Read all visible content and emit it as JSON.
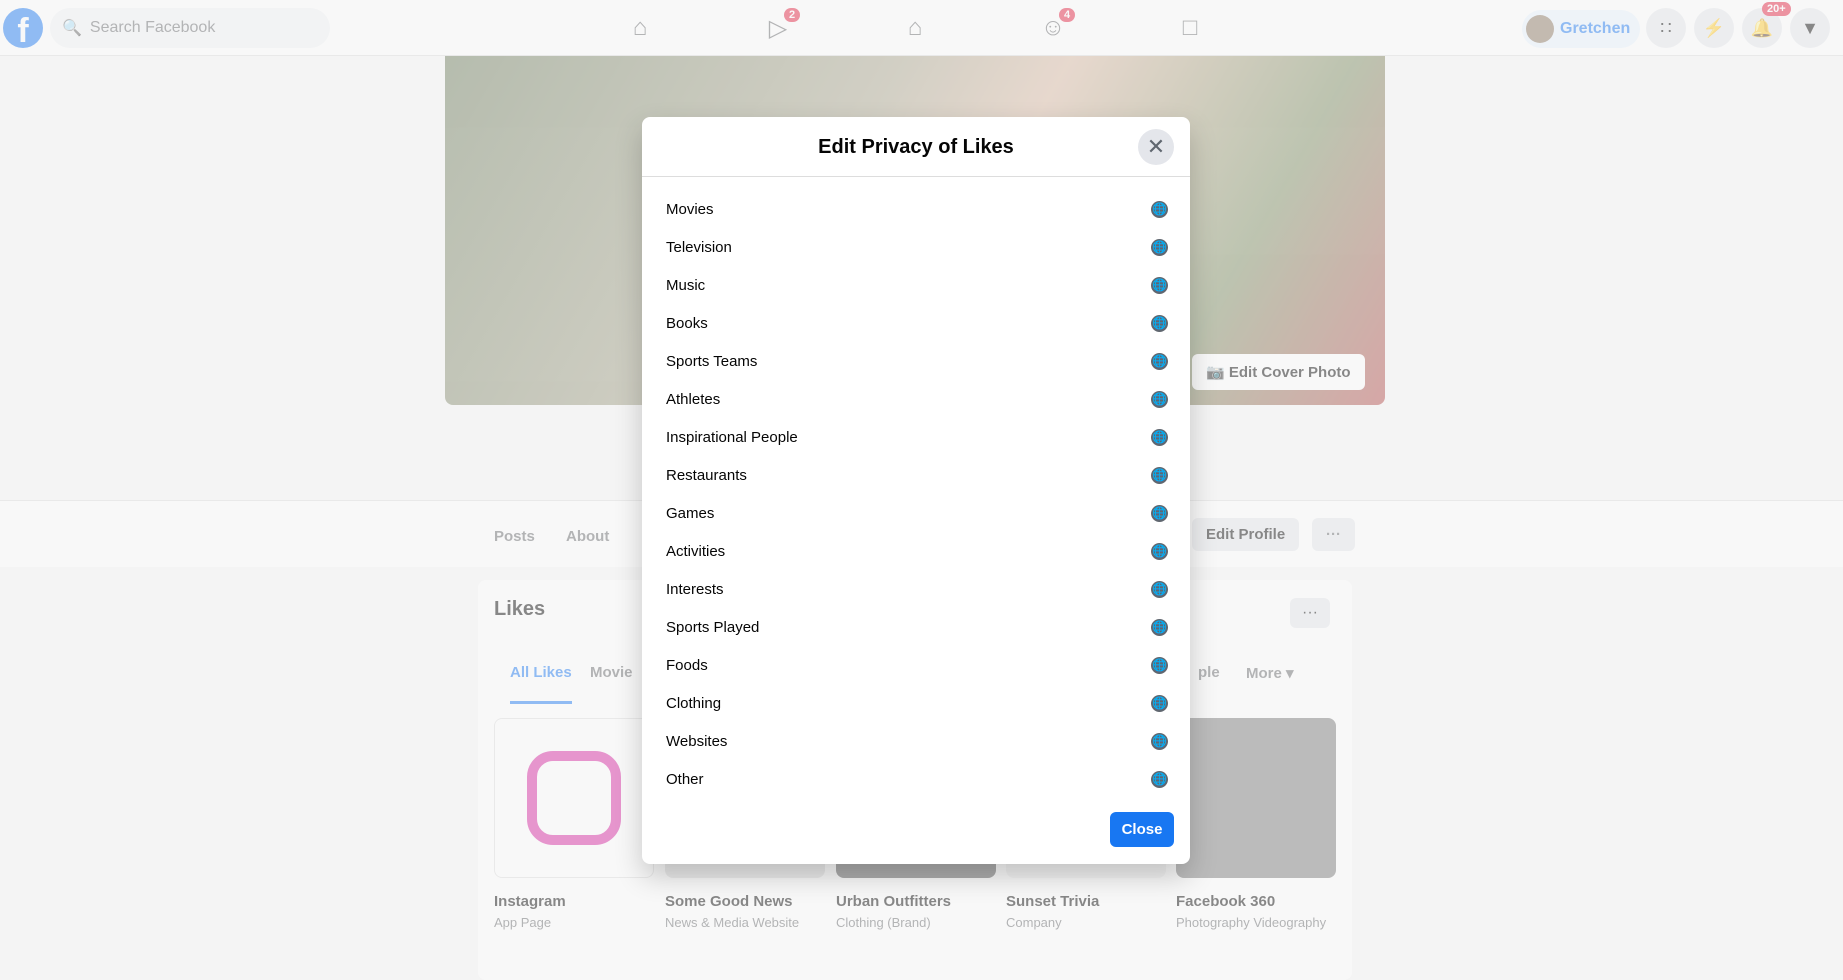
{
  "topbar": {
    "logo": "f",
    "search_placeholder": "Search Facebook",
    "watch_badge": "2",
    "groups_badge": "4",
    "user_name": "Gretchen",
    "notifications_badge": "20+"
  },
  "profile": {
    "edit_cover_label": "Edit Cover Photo",
    "tabs": [
      "Posts",
      "About"
    ],
    "edit_profile_label": "Edit Profile",
    "more_dots": "···"
  },
  "likes": {
    "title": "Likes",
    "tabs": [
      "All Likes",
      "Movie",
      "ple",
      "More ▾"
    ],
    "tiles": [
      {
        "name": "Instagram",
        "type": "App Page"
      },
      {
        "name": "Some Good News",
        "type": "News & Media Website"
      },
      {
        "name": "Urban Outfitters",
        "type": "Clothing (Brand)"
      },
      {
        "name": "Sunset Trivia",
        "type": "Company"
      },
      {
        "name": "Facebook 360",
        "type": "Photography Videography"
      }
    ]
  },
  "modal": {
    "title": "Edit Privacy of Likes",
    "close_label": "Close",
    "privacy_icon": "globe-icon",
    "categories": [
      "Movies",
      "Television",
      "Music",
      "Books",
      "Sports Teams",
      "Athletes",
      "Inspirational People",
      "Restaurants",
      "Games",
      "Activities",
      "Interests",
      "Sports Played",
      "Foods",
      "Clothing",
      "Websites",
      "Other"
    ]
  }
}
